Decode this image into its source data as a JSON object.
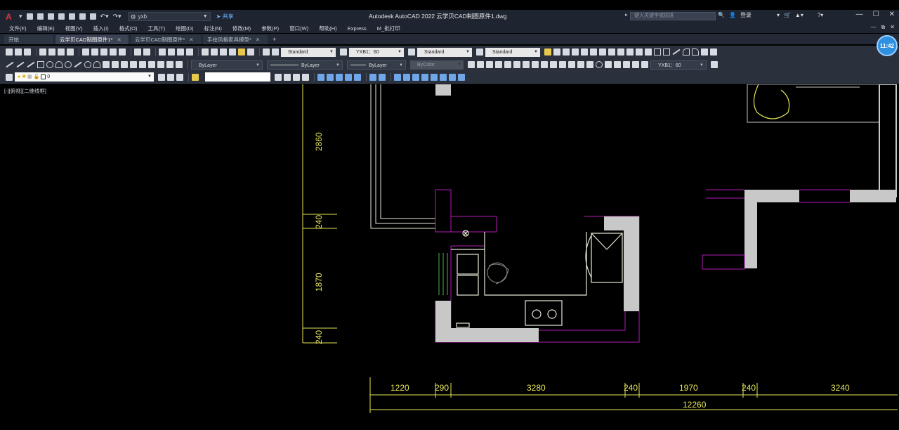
{
  "title_bar": {
    "logo": "A",
    "workspace": "yxb",
    "share": "共享",
    "app_title": "Autodesk AutoCAD 2022    云学贝CAD制图原件1.dwg",
    "search_placeholder": "键入关键字或短语",
    "sign_in": "登录"
  },
  "menu": {
    "items": [
      "文件(F)",
      "编辑(E)",
      "视图(V)",
      "插入(I)",
      "格式(O)",
      "工具(T)",
      "绘图(D)",
      "标注(N)",
      "修改(M)",
      "参数(P)",
      "窗口(W)",
      "帮助(H)",
      "Express",
      "M_批打印"
    ]
  },
  "tabs": [
    {
      "label": "开始",
      "active": false,
      "closable": false
    },
    {
      "label": "云学贝CAD制图原件1*",
      "active": true,
      "closable": true
    },
    {
      "label": "云学贝CAD制图原件*",
      "active": false,
      "closable": true
    },
    {
      "label": "手绘风格家具模型*",
      "active": false,
      "closable": true
    }
  ],
  "toolbar1": {
    "text_style": "Standard",
    "dim_style": "YXB1：60",
    "table_style": "Standard",
    "mleader_style": "Standard"
  },
  "toolbar2": {
    "color": "ByLayer",
    "linetype": "ByLayer",
    "lineweight": "ByLayer",
    "plot_style": "ByColor",
    "dim_scale": "YXB1：60"
  },
  "toolbar3": {
    "current_layer": "0"
  },
  "clock": "11:42",
  "viewport_label": "[-][俯视][二维线框]",
  "drawing": {
    "vertical_dims": [
      "2860",
      "240",
      "1870",
      "240"
    ],
    "horizontal_dims": [
      "1220",
      "290",
      "3280",
      "240",
      "1970",
      "240",
      "3240"
    ],
    "total_dim": "12260"
  },
  "colors": {
    "wall_fill": "#c8c8c8",
    "magenta": "#b01cb0",
    "dim_yellow": "#e6e65a",
    "fixture_white": "#e8e8d8"
  }
}
